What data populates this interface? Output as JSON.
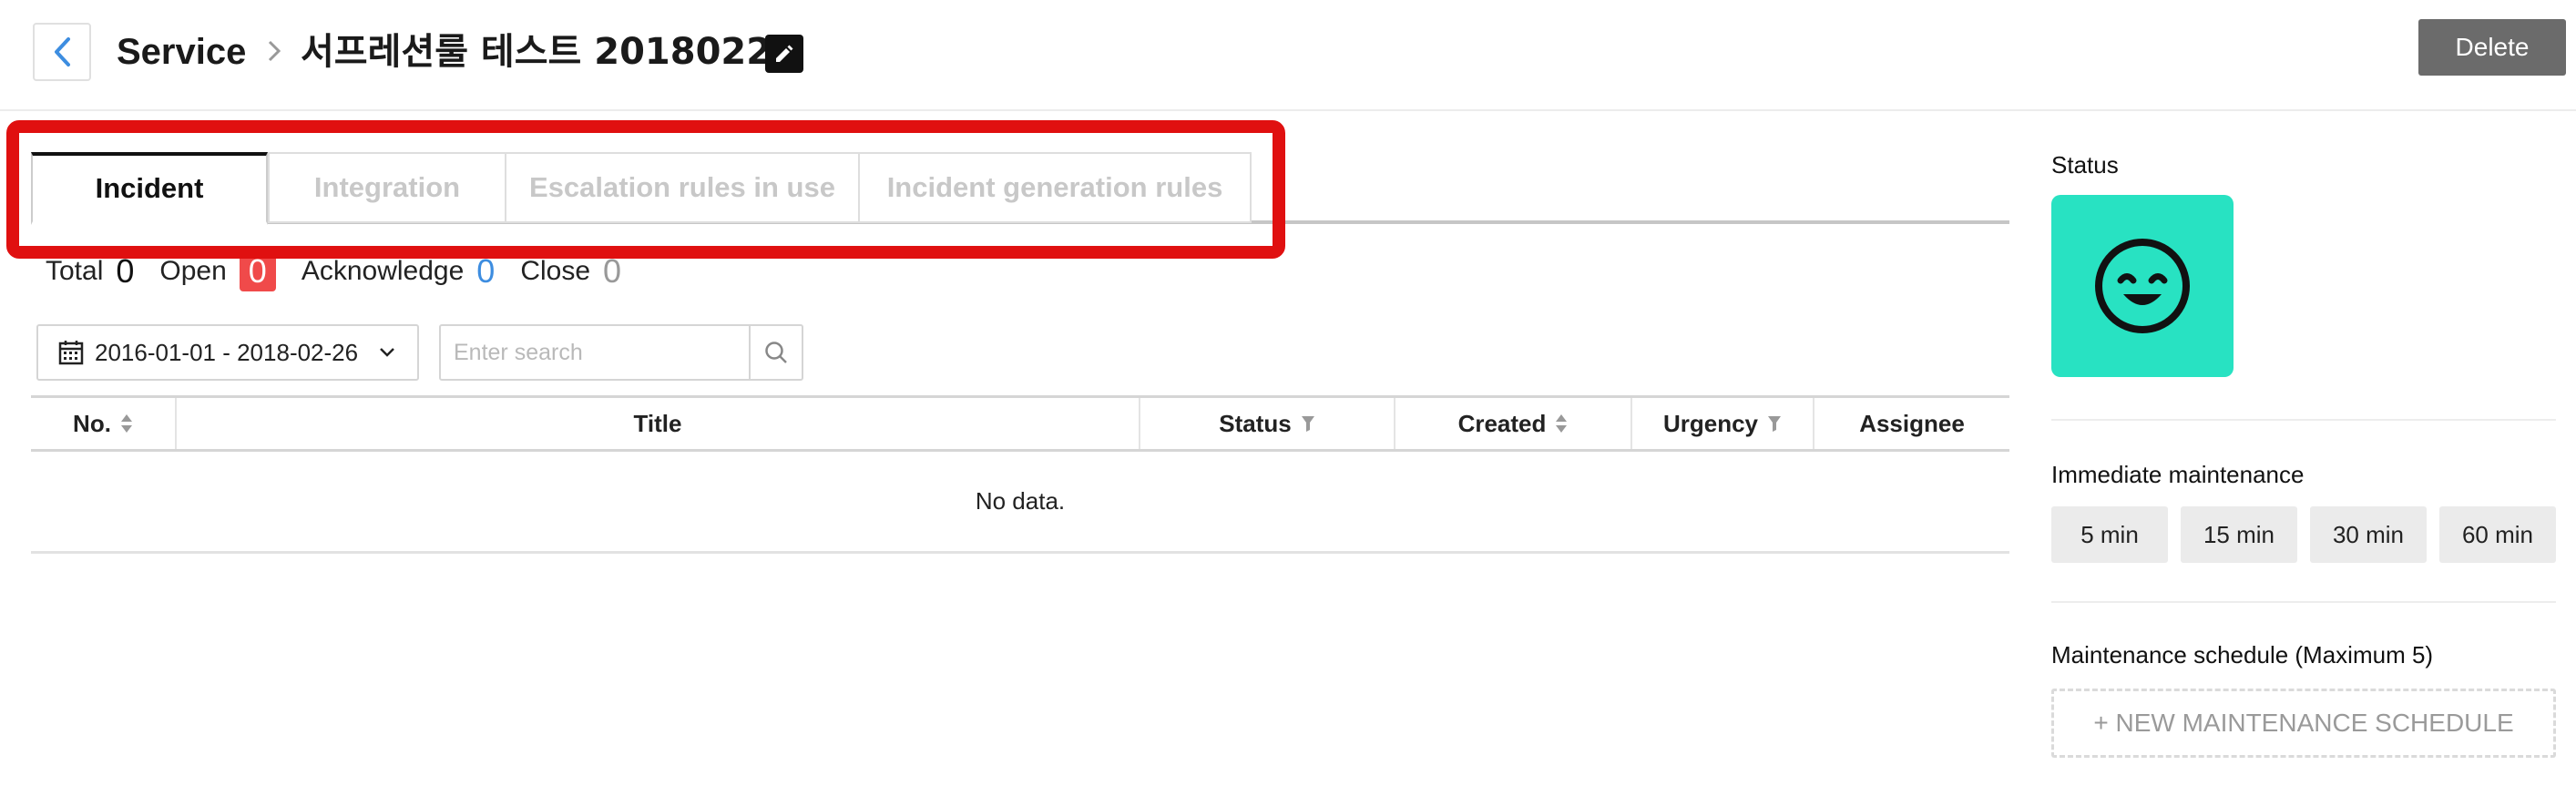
{
  "header": {
    "breadcrumb_root": "Service",
    "title": "서프레션룰 테스트 20180220",
    "delete_label": "Delete"
  },
  "tabs": [
    {
      "label": "Incident",
      "active": true
    },
    {
      "label": "Integration",
      "active": false
    },
    {
      "label": "Escalation rules in use",
      "active": false
    },
    {
      "label": "Incident generation rules",
      "active": false
    }
  ],
  "counts": {
    "total_label": "Total",
    "total": "0",
    "open_label": "Open",
    "open": "0",
    "ack_label": "Acknowledge",
    "ack": "0",
    "close_label": "Close",
    "close": "0"
  },
  "filters": {
    "date_range": "2016-01-01 - 2018-02-26",
    "search_placeholder": "Enter search"
  },
  "table": {
    "columns": [
      "No.",
      "Title",
      "Status",
      "Created",
      "Urgency",
      "Assignee"
    ],
    "empty_text": "No data."
  },
  "side": {
    "status_label": "Status",
    "status_icon": "smile-face-icon",
    "immediate_label": "Immediate maintenance",
    "maintenance_options": [
      "5 min",
      "15 min",
      "30 min",
      "60 min"
    ],
    "schedule_label": "Maintenance schedule (Maximum 5)",
    "new_schedule_label": "+ NEW MAINTENANCE SCHEDULE"
  },
  "colors": {
    "accent_blue": "#3d8de0",
    "open_red": "#f04a4a",
    "status_teal": "#28e2c2",
    "highlight_red": "#e01010",
    "delete_gray": "#6b6b6b"
  }
}
